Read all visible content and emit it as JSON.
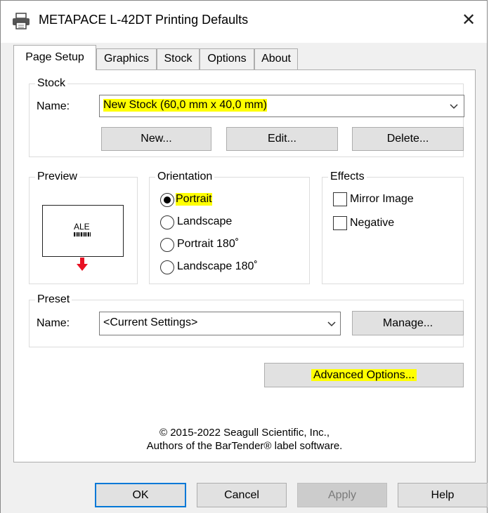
{
  "window": {
    "title": "METAPACE L-42DT Printing Defaults",
    "close_glyph": "✕",
    "title_icon": "printer-icon"
  },
  "tabs": [
    {
      "label": "Page Setup",
      "active": true
    },
    {
      "label": "Graphics",
      "active": false
    },
    {
      "label": "Stock",
      "active": false
    },
    {
      "label": "Options",
      "active": false
    },
    {
      "label": "About",
      "active": false
    }
  ],
  "stock": {
    "group_label": "Stock",
    "name_label": "Name:",
    "selected": "New Stock (60,0 mm x 40,0 mm)",
    "new_button": "New...",
    "edit_button": "Edit...",
    "delete_button": "Delete..."
  },
  "preview": {
    "group_label": "Preview",
    "sample_text": "ALE",
    "arrow_color": "#e81123"
  },
  "orientation": {
    "group_label": "Orientation",
    "options": [
      {
        "label": "Portrait",
        "selected": true
      },
      {
        "label": "Landscape",
        "selected": false
      },
      {
        "label": "Portrait 180˚",
        "selected": false
      },
      {
        "label": "Landscape 180˚",
        "selected": false
      }
    ]
  },
  "effects": {
    "group_label": "Effects",
    "options": [
      {
        "label": "Mirror Image",
        "checked": false
      },
      {
        "label": "Negative",
        "checked": false
      }
    ]
  },
  "preset": {
    "group_label": "Preset",
    "name_label": "Name:",
    "selected": "<Current Settings>",
    "manage_button": "Manage..."
  },
  "advanced_button": "Advanced Options...",
  "copyright": {
    "line1": "© 2015-2022 Seagull Scientific, Inc.,",
    "line2": "Authors of the BarTender® label software."
  },
  "footer": {
    "ok": "OK",
    "cancel": "Cancel",
    "apply": "Apply",
    "help": "Help"
  },
  "colors": {
    "highlight": "#ffff00",
    "focus_border": "#0078d7"
  }
}
